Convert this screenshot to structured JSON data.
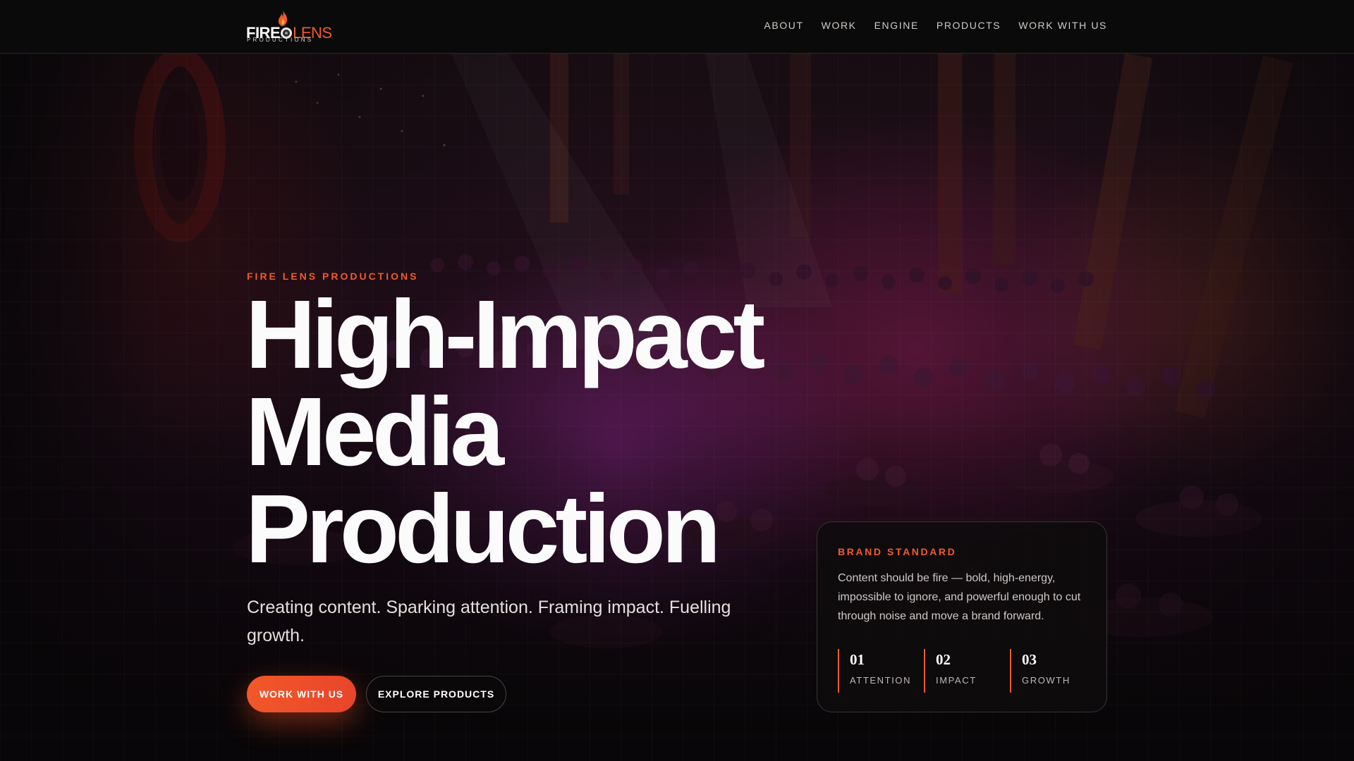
{
  "header": {
    "logo": {
      "word_fire": "FIRE",
      "word_lens": "LENS",
      "tagline": "PRODUCTIONS"
    },
    "nav": [
      "ABOUT",
      "WORK",
      "ENGINE",
      "PRODUCTS",
      "WORK WITH US"
    ]
  },
  "hero": {
    "eyebrow": "FIRE LENS PRODUCTIONS",
    "headline": [
      "High-Impact",
      "Media",
      "Production"
    ],
    "subhead": "Creating content. Sparking attention. Framing impact. Fuelling growth.",
    "primary_button": "WORK WITH US",
    "secondary_button": "EXPLORE PRODUCTS"
  },
  "card": {
    "title": "BRAND STANDARD",
    "body": "Content should be fire — bold, high-energy, impossible to ignore, and powerful enough to cut through noise and move a brand forward.",
    "stats": [
      {
        "num": "01",
        "label": "ATTENTION"
      },
      {
        "num": "02",
        "label": "IMPACT"
      },
      {
        "num": "03",
        "label": "GROWTH"
      }
    ]
  },
  "colors": {
    "accent": "#ee5b2c",
    "background": "#0a0a0a",
    "text": "#fbfbfb"
  },
  "icons": [
    "flame-icon",
    "lens-icon"
  ]
}
